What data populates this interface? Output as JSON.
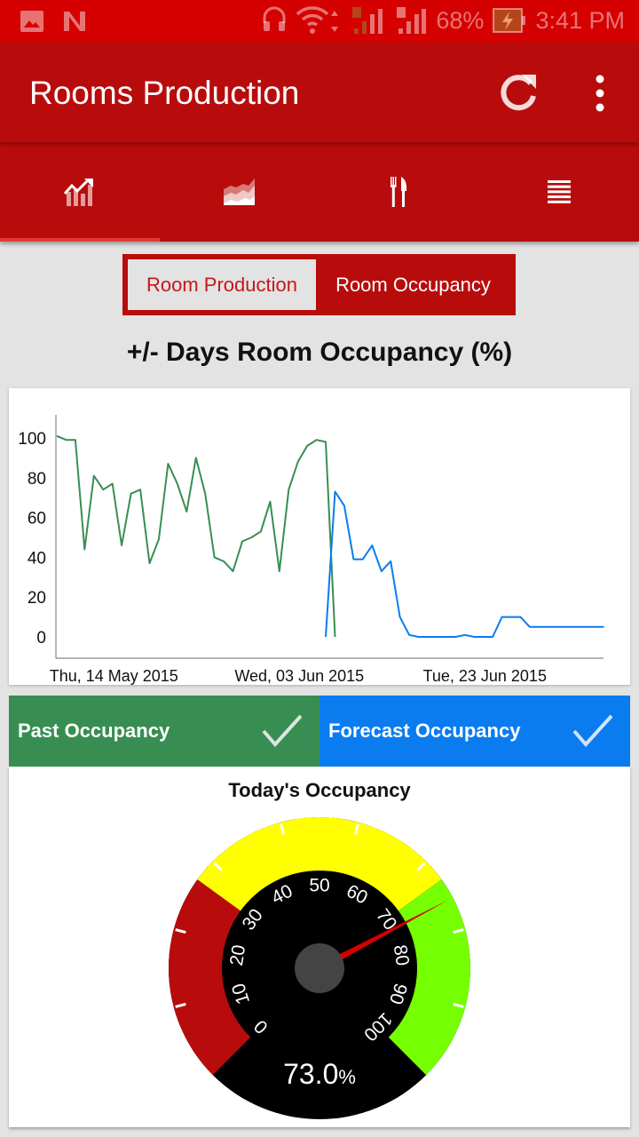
{
  "status_bar": {
    "left_icons": [
      "gallery-icon",
      "notification-n-icon"
    ],
    "right_icons": [
      "headset-icon",
      "wifi-icon",
      "sim1-signal-icon",
      "sim2-signal-icon",
      "battery-charging-icon"
    ],
    "battery": "68%",
    "time": "3:41 PM"
  },
  "app_bar": {
    "title": "Rooms Production",
    "actions": [
      "refresh-icon",
      "overflow-menu-icon"
    ]
  },
  "tabs": [
    {
      "icon": "bar-chart-trend-icon",
      "active": true
    },
    {
      "icon": "area-chart-icon",
      "active": false
    },
    {
      "icon": "fork-knife-icon",
      "active": false
    },
    {
      "icon": "list-icon",
      "active": false
    }
  ],
  "segment": {
    "options": [
      "Room Production",
      "Room Occupancy"
    ],
    "selected": "Room Production"
  },
  "colors": {
    "primary": "#b80c0c",
    "status_bar": "#d50000",
    "past": "#388e52",
    "forecast": "#0a7cf0",
    "gauge_red": "#b80c0c",
    "gauge_yellow": "#ffff00",
    "gauge_green": "#76ff03"
  },
  "chart_data": {
    "type": "line",
    "title": "+/- Days Room Occupancy (%)",
    "xlabel": "",
    "ylabel": "",
    "ylim": [
      0,
      100
    ],
    "yticks": [
      0,
      20,
      40,
      60,
      80,
      100
    ],
    "xtick_labels": [
      {
        "label": "Thu, 14 May 2015",
        "index": 5
      },
      {
        "label": "Wed, 03 Jun 2015",
        "index": 25
      },
      {
        "label": "Tue, 23 Jun 2015",
        "index": 45
      }
    ],
    "x_count": 60,
    "grid": false,
    "series": [
      {
        "name": "Past Occupancy",
        "start_index": 0,
        "values": [
          101,
          99,
          99,
          44,
          81,
          74,
          77,
          46,
          72,
          74,
          37,
          49,
          87,
          77,
          63,
          90,
          72,
          40,
          38,
          33,
          48,
          50,
          53,
          68,
          33,
          74,
          88,
          96,
          99,
          98,
          0
        ]
      },
      {
        "name": "Forecast Occupancy",
        "start_index": 29,
        "values": [
          0,
          73,
          66,
          39,
          39,
          46,
          33,
          38,
          10,
          1,
          0,
          0,
          0,
          0,
          0,
          1,
          0,
          0,
          0,
          10,
          10,
          10,
          5,
          5,
          5,
          5,
          5,
          5,
          5,
          5,
          5
        ]
      }
    ]
  },
  "legend": [
    {
      "label": "Past Occupancy",
      "checked": true
    },
    {
      "label": "Forecast Occupancy",
      "checked": true
    }
  ],
  "gauge": {
    "title": "Today's Occupancy",
    "value": 73.0,
    "value_text": "73.0",
    "unit": "%",
    "min": 0,
    "max": 100,
    "scale_labels": [
      "0",
      "10",
      "20",
      "30",
      "40",
      "50",
      "60",
      "70",
      "80",
      "90",
      "100"
    ],
    "zones": [
      {
        "from": 0,
        "to": 30,
        "color": "#b80c0c"
      },
      {
        "from": 30,
        "to": 70,
        "color": "#ffff00"
      },
      {
        "from": 70,
        "to": 100,
        "color": "#76ff03"
      }
    ]
  }
}
